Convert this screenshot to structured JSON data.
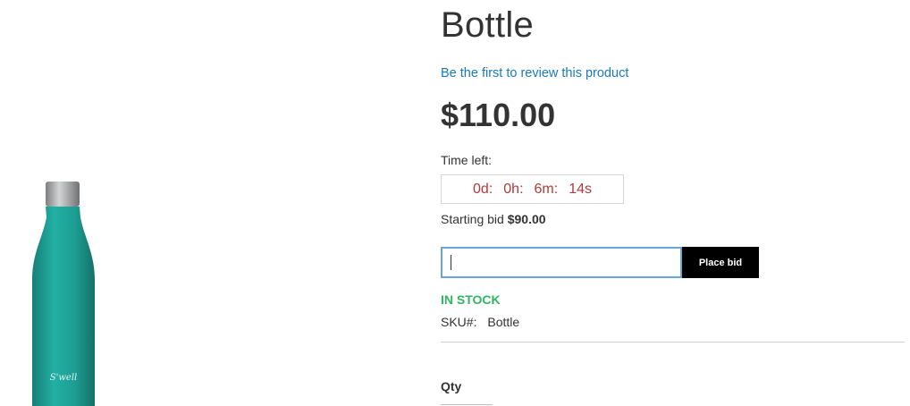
{
  "product": {
    "title": "Bottle",
    "review_link": "Be the first to review this product",
    "price": "$110.00",
    "image_brand": "S'well",
    "image_colors": {
      "body": "#1d9c92",
      "cap": "#a9abad"
    }
  },
  "auction": {
    "time_left_label": "Time left:",
    "countdown": {
      "days": "0d:",
      "hours": "0h:",
      "minutes": "6m:",
      "seconds": "14s"
    },
    "starting_bid_label": "Starting bid",
    "starting_bid_value": "$90.00",
    "bid_input_value": "",
    "place_bid_label": "Place bid"
  },
  "stock": {
    "status": "IN STOCK",
    "sku_label": "SKU#:",
    "sku_value": "Bottle"
  },
  "qty": {
    "label": "Qty"
  },
  "colors": {
    "link": "#1979c3",
    "countdown": "#b23a3a",
    "in_stock": "#2fb55f",
    "button_bg": "#000000",
    "input_border": "#6aa5d8"
  }
}
